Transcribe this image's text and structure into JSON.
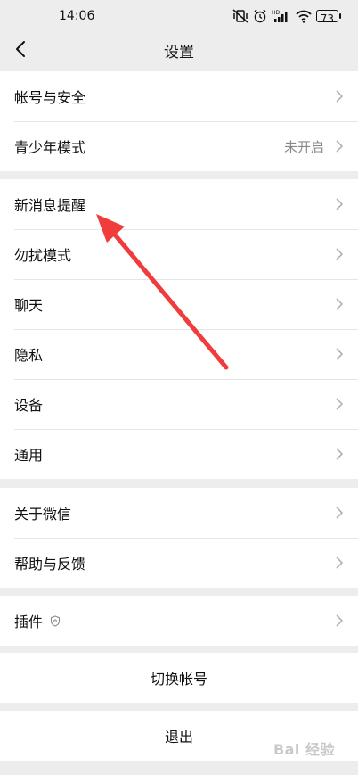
{
  "status_bar": {
    "time": "14:06",
    "icons": [
      "vibrate-off-icon",
      "alarm-icon",
      "hd-signal-icon",
      "wifi-icon"
    ],
    "battery": "73"
  },
  "nav": {
    "title": "设置"
  },
  "groups": [
    {
      "items": [
        {
          "label": "帐号与安全"
        },
        {
          "label": "青少年模式",
          "value": "未开启"
        }
      ]
    },
    {
      "items": [
        {
          "label": "新消息提醒"
        },
        {
          "label": "勿扰模式"
        },
        {
          "label": "聊天"
        },
        {
          "label": "隐私"
        },
        {
          "label": "设备"
        },
        {
          "label": "通用"
        }
      ]
    },
    {
      "items": [
        {
          "label": "关于微信"
        },
        {
          "label": "帮助与反馈"
        }
      ]
    },
    {
      "items": [
        {
          "label": "插件"
        }
      ]
    }
  ],
  "actions": {
    "switch_account": "切换帐号",
    "logout": "退出"
  },
  "annotation": {
    "color": "#f03c3c"
  },
  "watermark": "Bai 经验"
}
